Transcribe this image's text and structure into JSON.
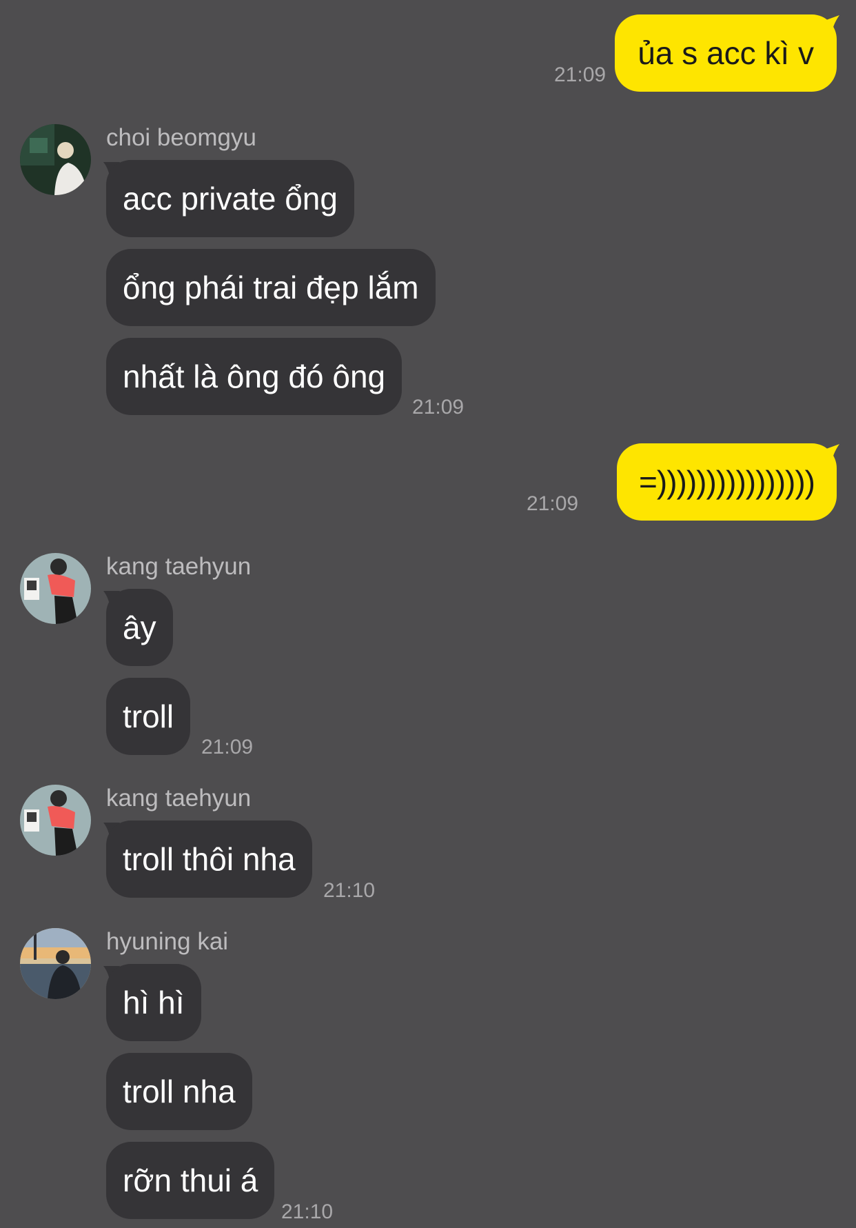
{
  "colors": {
    "background": "#4e4d4f",
    "received_bubble": "#353437",
    "sent_bubble": "#fee500",
    "timestamp": "#a9a8aa",
    "sender_name": "#bdbcbe"
  },
  "messages": [
    {
      "type": "sent",
      "text": "ủa s acc kì v",
      "time": "21:09"
    },
    {
      "type": "received",
      "sender": "choi beomgyu",
      "avatar": "avatar-choi-beomgyu",
      "bubbles": [
        "acc private ổng",
        "ổng phái trai đẹp lắm",
        "nhất là ông đó ông"
      ],
      "time": "21:09"
    },
    {
      "type": "sent",
      "text": "=))))))))))))))))",
      "time": "21:09"
    },
    {
      "type": "received",
      "sender": "kang taehyun",
      "avatar": "avatar-kang-taehyun",
      "bubbles": [
        "ây",
        "troll"
      ],
      "time": "21:09"
    },
    {
      "type": "received",
      "sender": "kang taehyun",
      "avatar": "avatar-kang-taehyun",
      "bubbles": [
        "troll thôi nha"
      ],
      "time": "21:10"
    },
    {
      "type": "received",
      "sender": "hyuning kai",
      "avatar": "avatar-hyuning-kai",
      "bubbles": [
        "hì hì",
        "troll nha",
        "rỡn thui á"
      ],
      "time": "21:10"
    }
  ]
}
